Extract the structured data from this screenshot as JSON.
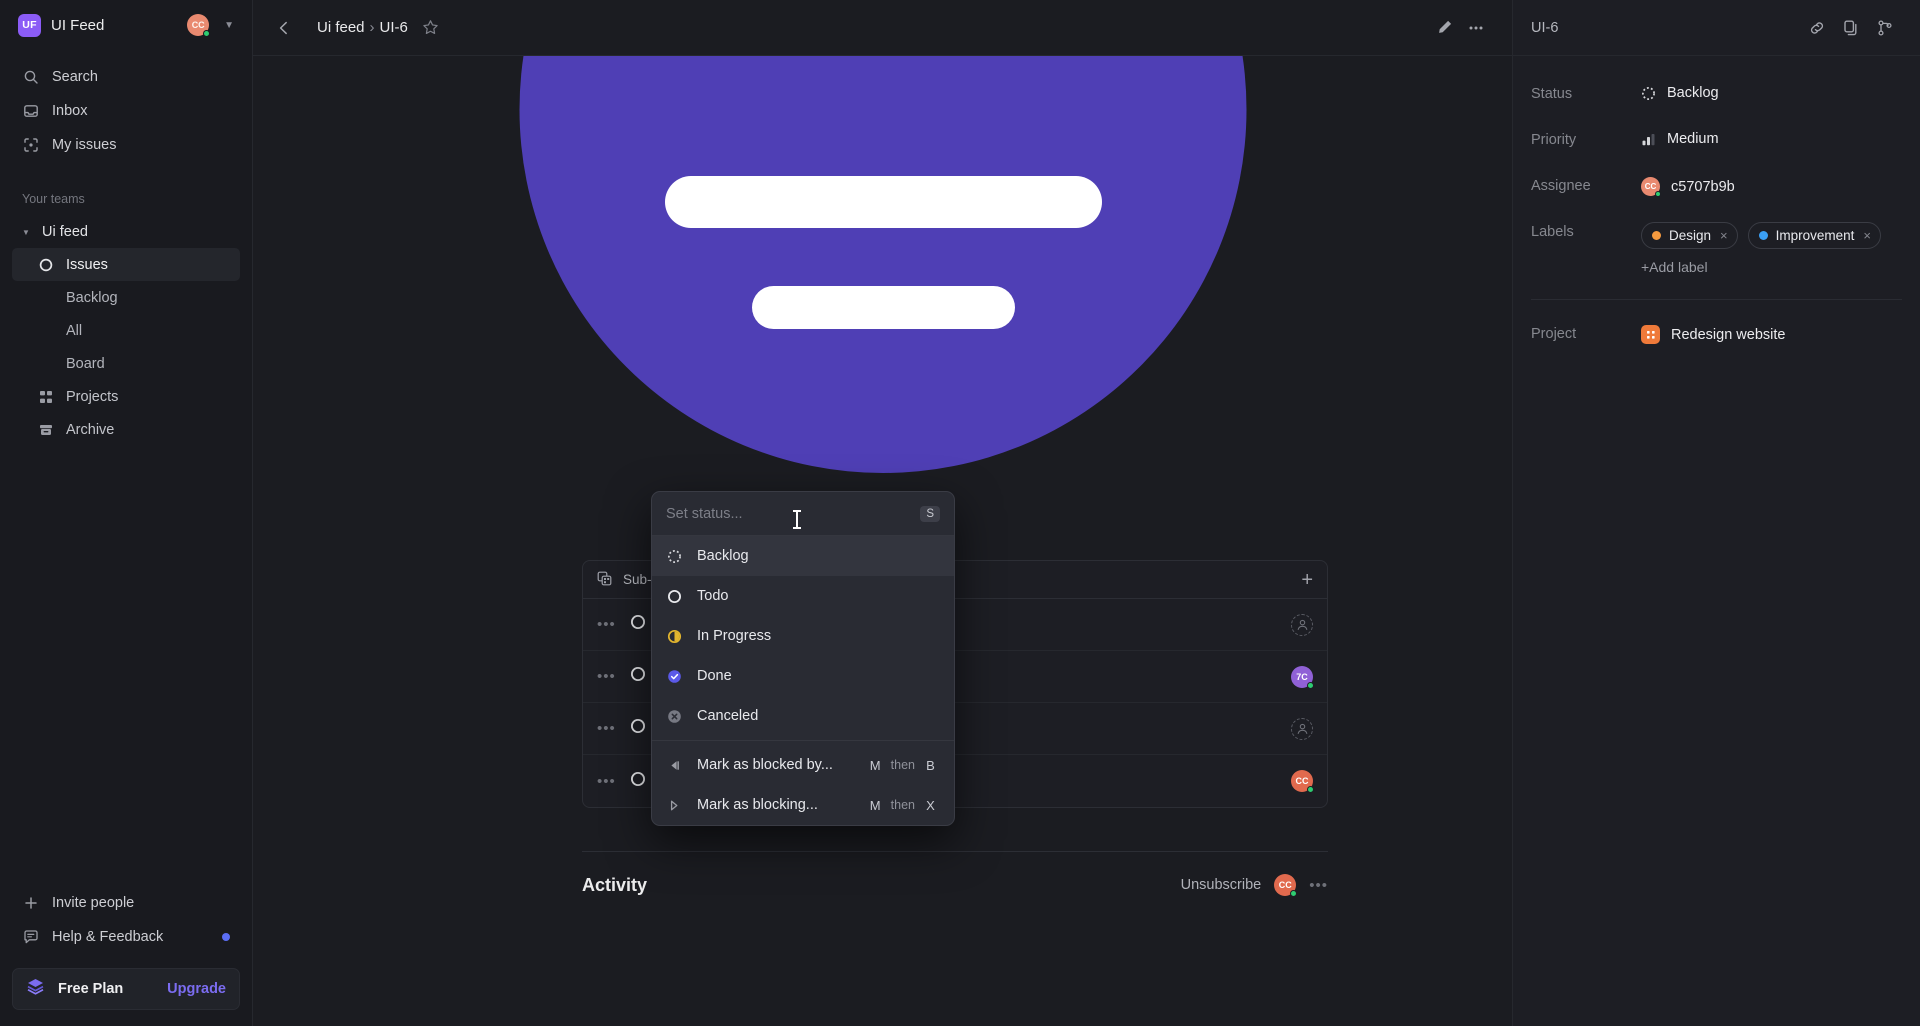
{
  "sidebar": {
    "workspace": {
      "badge": "UF",
      "name": "UI Feed",
      "avatar_initials": "CC"
    },
    "nav": [
      {
        "label": "Search",
        "icon": "search-icon"
      },
      {
        "label": "Inbox",
        "icon": "inbox-icon"
      },
      {
        "label": "My issues",
        "icon": "my-issues-icon"
      }
    ],
    "teams_title": "Your teams",
    "team": {
      "name": "Ui feed"
    },
    "team_items": [
      {
        "label": "Issues",
        "icon": "circle-icon",
        "active": true
      },
      {
        "label": "Backlog",
        "icon": "",
        "active": false
      },
      {
        "label": "All",
        "icon": "",
        "active": false
      },
      {
        "label": "Board",
        "icon": "",
        "active": false
      },
      {
        "label": "Projects",
        "icon": "projects-icon",
        "active": false
      },
      {
        "label": "Archive",
        "icon": "archive-icon",
        "active": false
      }
    ],
    "bottom": [
      {
        "label": "Invite people",
        "icon": "plus-icon"
      },
      {
        "label": "Help & Feedback",
        "icon": "feedback-icon"
      }
    ],
    "plan": {
      "name": "Free Plan",
      "upgrade": "Upgrade"
    }
  },
  "header": {
    "breadcrumb_team": "Ui feed",
    "breadcrumb_sep": "›",
    "breadcrumb_issue": "UI-6",
    "edit_icon": "pencil-icon",
    "more_icon": "more-horizontal-icon"
  },
  "main": {
    "sub_issues": {
      "title": "Sub-issues",
      "rows": [
        {
          "avatar": "",
          "avatar_color": ""
        },
        {
          "avatar": "7C",
          "avatar_color": "#9061d6"
        },
        {
          "avatar": "",
          "avatar_color": ""
        },
        {
          "avatar": "CC",
          "avatar_color": "#e16a4e"
        }
      ]
    },
    "activity": {
      "title": "Activity",
      "unsubscribe": "Unsubscribe",
      "avatar": "CC",
      "more": "more-horizontal-icon"
    }
  },
  "dropdown": {
    "placeholder": "Set status...",
    "value": "",
    "shortcut_badge": "S",
    "statuses": [
      {
        "label": "Backlog",
        "icon": "status-backlog-icon",
        "selected": true
      },
      {
        "label": "Todo",
        "icon": "status-todo-icon",
        "selected": false
      },
      {
        "label": "In Progress",
        "icon": "status-in-progress-icon",
        "selected": false
      },
      {
        "label": "Done",
        "icon": "status-done-icon",
        "selected": false
      },
      {
        "label": "Canceled",
        "icon": "status-canceled-icon",
        "selected": false
      }
    ],
    "actions": [
      {
        "label": "Mark as blocked by...",
        "icon": "blocked-by-icon",
        "key1": "M",
        "then": "then",
        "key2": "B"
      },
      {
        "label": "Mark as blocking...",
        "icon": "blocking-icon",
        "key1": "M",
        "then": "then",
        "key2": "X"
      }
    ]
  },
  "right_panel": {
    "issue_id": "UI-6",
    "icons": [
      {
        "name": "link-icon"
      },
      {
        "name": "copy-icon"
      },
      {
        "name": "branch-icon"
      }
    ],
    "properties": {
      "status_label": "Status",
      "status_value": "Backlog",
      "priority_label": "Priority",
      "priority_value": "Medium",
      "assignee_label": "Assignee",
      "assignee_value": "c5707b9b",
      "assignee_initials": "CC",
      "labels_label": "Labels",
      "labels": [
        {
          "name": "Design",
          "color": "#f59a3f"
        },
        {
          "name": "Improvement",
          "color": "#3ba0f5"
        }
      ],
      "add_label": "+Add label",
      "project_label": "Project",
      "project_value": "Redesign website"
    }
  },
  "colors": {
    "accent_purple": "#4f3fb5",
    "brand_violet": "#8b5cf6",
    "upgrade": "#7b6cf0",
    "done_blue": "#5b59e8",
    "in_progress_yellow": "#e2b52e",
    "project_orange": "#ef7a3a"
  }
}
